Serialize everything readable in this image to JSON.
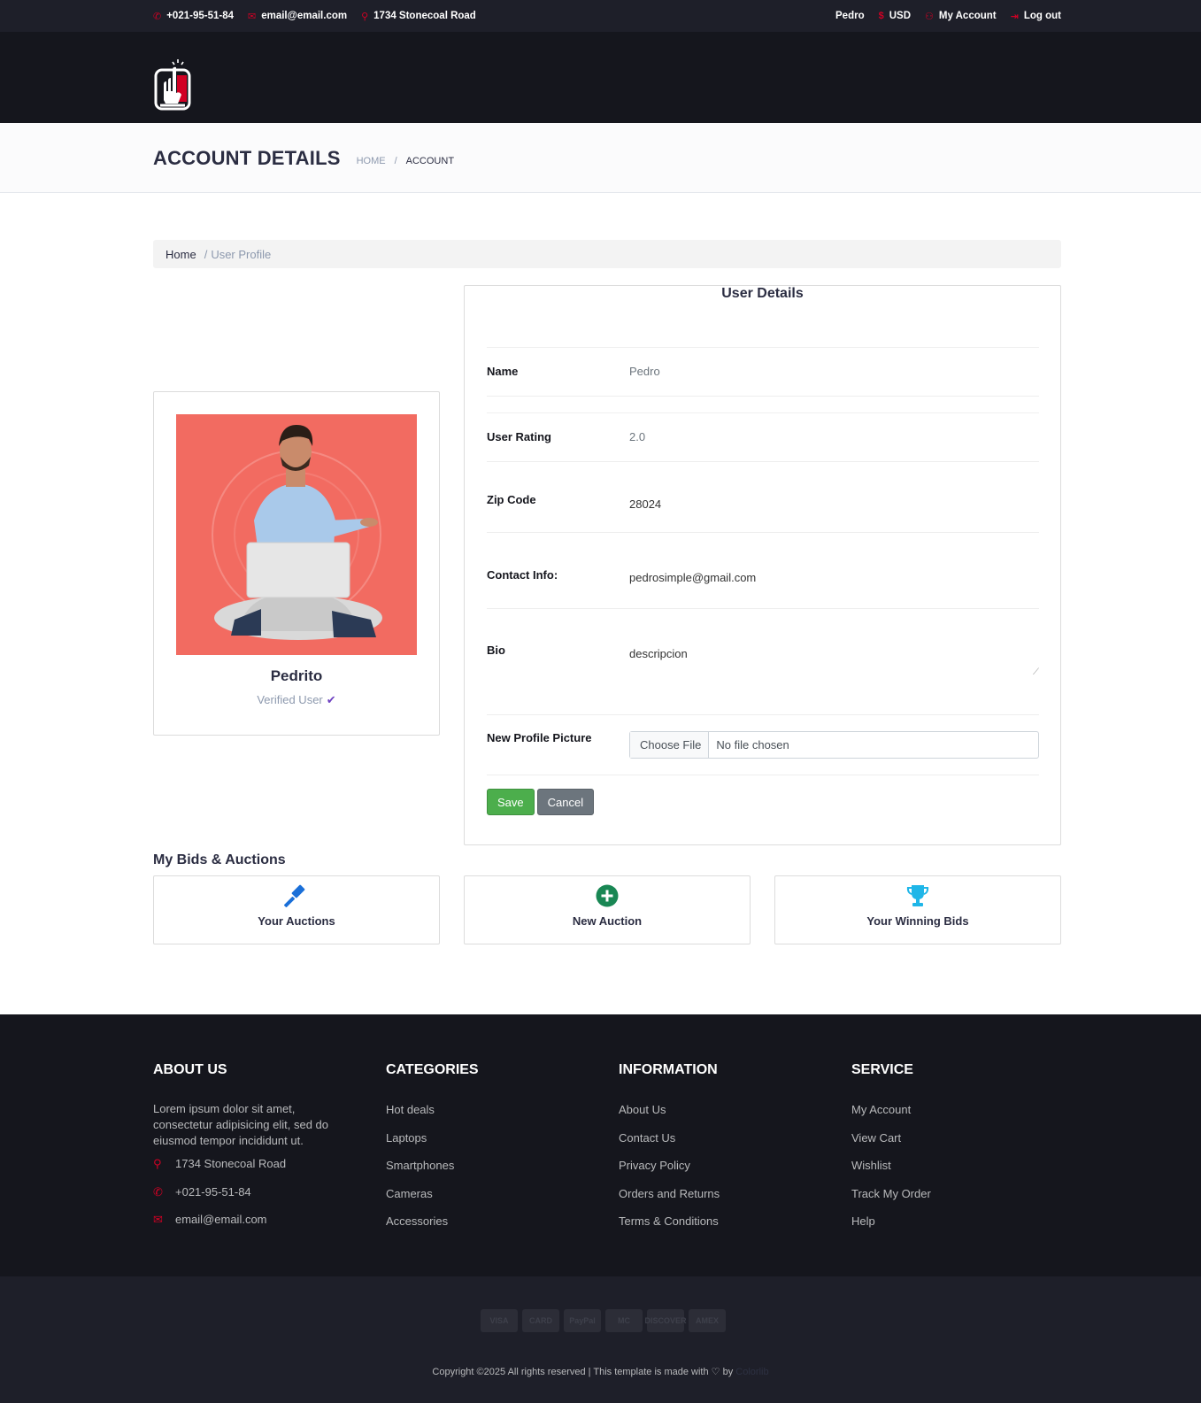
{
  "topbar": {
    "phone": "+021-95-51-84",
    "email": "email@email.com",
    "address": "1734 Stonecoal Road",
    "user": "Pedro",
    "currency": "USD",
    "my_account": "My Account",
    "logout": "Log out"
  },
  "page": {
    "title": "ACCOUNT DETAILS",
    "crumb_home": "HOME",
    "crumb_sep": "/",
    "crumb_current": "ACCOUNT"
  },
  "breadcrumb": {
    "home": "Home",
    "sep": "/",
    "current": "User Profile"
  },
  "profile_card": {
    "name": "Pedrito",
    "verified": "Verified User",
    "check": "✔"
  },
  "details": {
    "title": "User Details",
    "name_label": "Name",
    "name_value": "Pedro",
    "rating_label": "User Rating",
    "rating_value": "2.0",
    "zip_label": "Zip Code",
    "zip_value": "28024",
    "contact_label": "Contact Info:",
    "contact_value": "pedrosimple@gmail.com",
    "bio_label": "Bio",
    "bio_value": "descripcion",
    "picture_label": "New Profile Picture",
    "choose_file": "Choose File",
    "no_file": "No file chosen",
    "save": "Save",
    "cancel": "Cancel"
  },
  "bids": {
    "title": "My Bids & Auctions",
    "tiles": [
      {
        "label": "Your Auctions",
        "icon": "gavel-icon"
      },
      {
        "label": "New Auction",
        "icon": "plus-circle-icon"
      },
      {
        "label": "Your Winning Bids",
        "icon": "trophy-icon"
      }
    ]
  },
  "footer": {
    "about": {
      "title": "ABOUT US",
      "text": "Lorem ipsum dolor sit amet, consectetur adipisicing elit, sed do eiusmod tempor incididunt ut.",
      "address": "1734 Stonecoal Road",
      "phone": "+021-95-51-84",
      "email": "email@email.com"
    },
    "categories": {
      "title": "CATEGORIES",
      "items": [
        "Hot deals",
        "Laptops",
        "Smartphones",
        "Cameras",
        "Accessories"
      ]
    },
    "information": {
      "title": "INFORMATION",
      "items": [
        "About Us",
        "Contact Us",
        "Privacy Policy",
        "Orders and Returns",
        "Terms & Conditions"
      ]
    },
    "service": {
      "title": "SERVICE",
      "items": [
        "My Account",
        "View Cart",
        "Wishlist",
        "Track My Order",
        "Help"
      ]
    },
    "payment": [
      "VISA",
      "CARD",
      "PayPal",
      "MC",
      "DISCOVER",
      "AMEX"
    ],
    "copyright": "Copyright ©2025 All rights reserved | This template is made with",
    "by": "by",
    "credit": "Colorlib"
  },
  "colors": {
    "accent": "#d10024",
    "dark": "#15161d",
    "save": "#4cae4c",
    "cancel": "#6c757d"
  }
}
